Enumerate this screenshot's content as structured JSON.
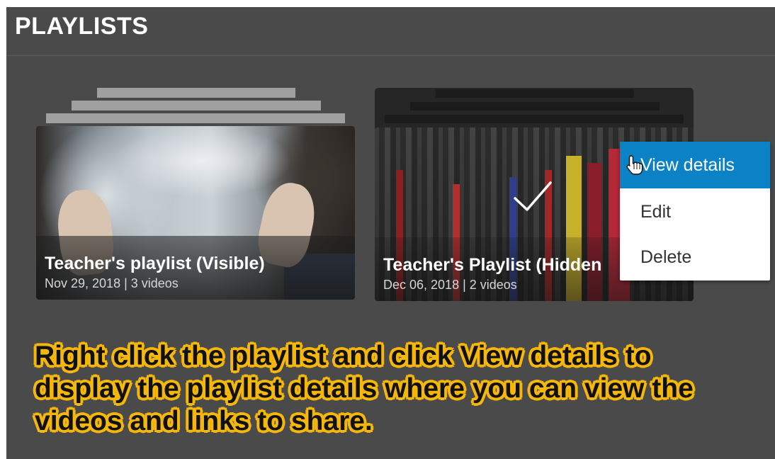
{
  "header": {
    "title": "PLAYLISTS"
  },
  "playlists": [
    {
      "title": "Teacher's playlist (Visible)",
      "meta": "Nov 29, 2018 | 3 videos"
    },
    {
      "title": "Teacher's Playlist (Hidden",
      "meta": "Dec 06, 2018 | 2 videos",
      "selected": true
    }
  ],
  "context_menu": {
    "items": [
      {
        "label": "View details",
        "highlighted": true
      },
      {
        "label": "Edit"
      },
      {
        "label": "Delete"
      }
    ]
  },
  "instruction": {
    "lines": [
      "Right click the playlist and click View details to",
      "display the playlist details where you can view the",
      "videos and links to share."
    ]
  },
  "colors": {
    "panel_bg": "#4a4a4a",
    "menu_highlight": "#0b82c6",
    "callout_outline": "#f5b70a"
  },
  "icons": {
    "selected_mark": "checkmark-icon",
    "pointer": "hand-pointer-icon"
  }
}
